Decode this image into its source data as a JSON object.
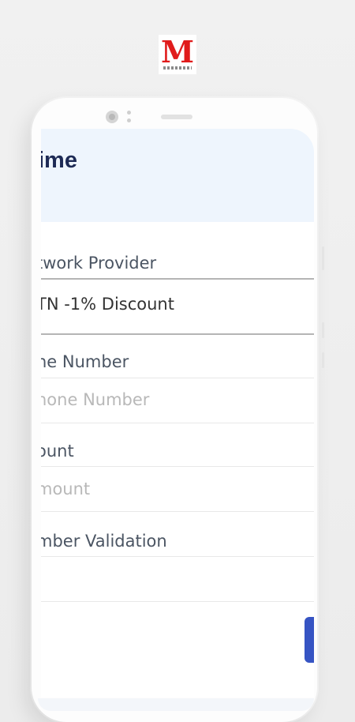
{
  "header": {
    "title": "ime"
  },
  "form": {
    "network_provider": {
      "label": "twork Provider",
      "value": "TN -1% Discount"
    },
    "phone_number": {
      "label": "ne Number",
      "placeholder": "hone Number"
    },
    "amount": {
      "label": "ount",
      "placeholder": "mount"
    },
    "number_validation": {
      "label": "mber Validation",
      "value": ""
    }
  },
  "colors": {
    "header_bg": "#eef5fd",
    "title": "#1d2a55",
    "accent": "#3654c3",
    "logo": "#e01b1b"
  }
}
